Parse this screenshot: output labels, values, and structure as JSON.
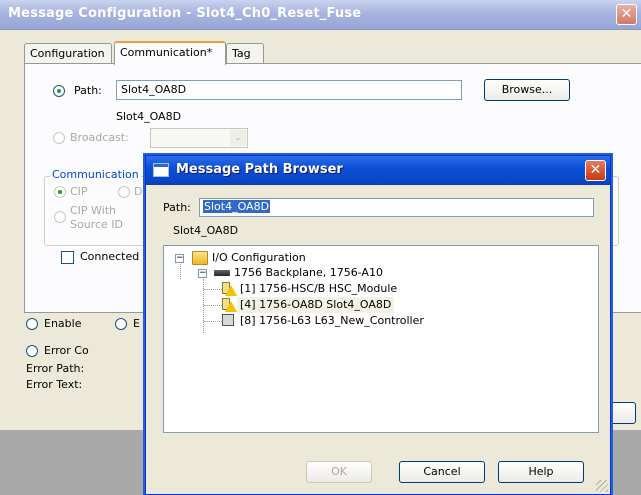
{
  "main": {
    "title": "Message Configuration - Slot4_Ch0_Reset_Fuse",
    "close_glyph": "✕",
    "tabs": [
      {
        "label": "Configuration"
      },
      {
        "label": "Communication*"
      },
      {
        "label": "Tag"
      }
    ],
    "path_label": "Path:",
    "path_value": "Slot4_OA8D",
    "path_resolved": "Slot4_OA8D",
    "browse_label": "Browse...",
    "broadcast_label": "Broadcast:",
    "comm_group_label": "Communication",
    "cip_label": "CIP",
    "d_label": "D",
    "cip_source_label_1": "CIP With",
    "cip_source_label_2": "Source ID",
    "connected_label": "Connected",
    "enable_label": "Enable",
    "e_label": "E",
    "error_code_label": "Error Co",
    "error_path_label": "Error Path:",
    "error_text_label": "Error Text:",
    "combo_arrow": "⌄"
  },
  "browser": {
    "title": "Message Path Browser",
    "close_glyph": "✕",
    "path_label": "Path:",
    "path_value": "Slot4_OA8D",
    "path_resolved": "Slot4_OA8D",
    "tree": {
      "root": {
        "label": "I/O Configuration",
        "expander": "−"
      },
      "backplane": {
        "label": "1756 Backplane, 1756-A10",
        "expander": "−"
      },
      "items": [
        {
          "label": "[1] 1756-HSC/B HSC_Module",
          "icon": "warning-module-icon"
        },
        {
          "label": "[4] 1756-OA8D Slot4_OA8D",
          "icon": "warning-module-icon",
          "selected": true
        },
        {
          "label": "[8] 1756-L63 L63_New_Controller",
          "icon": "controller-icon"
        }
      ]
    },
    "ok_label": "OK",
    "cancel_label": "Cancel",
    "help_label": "Help"
  }
}
